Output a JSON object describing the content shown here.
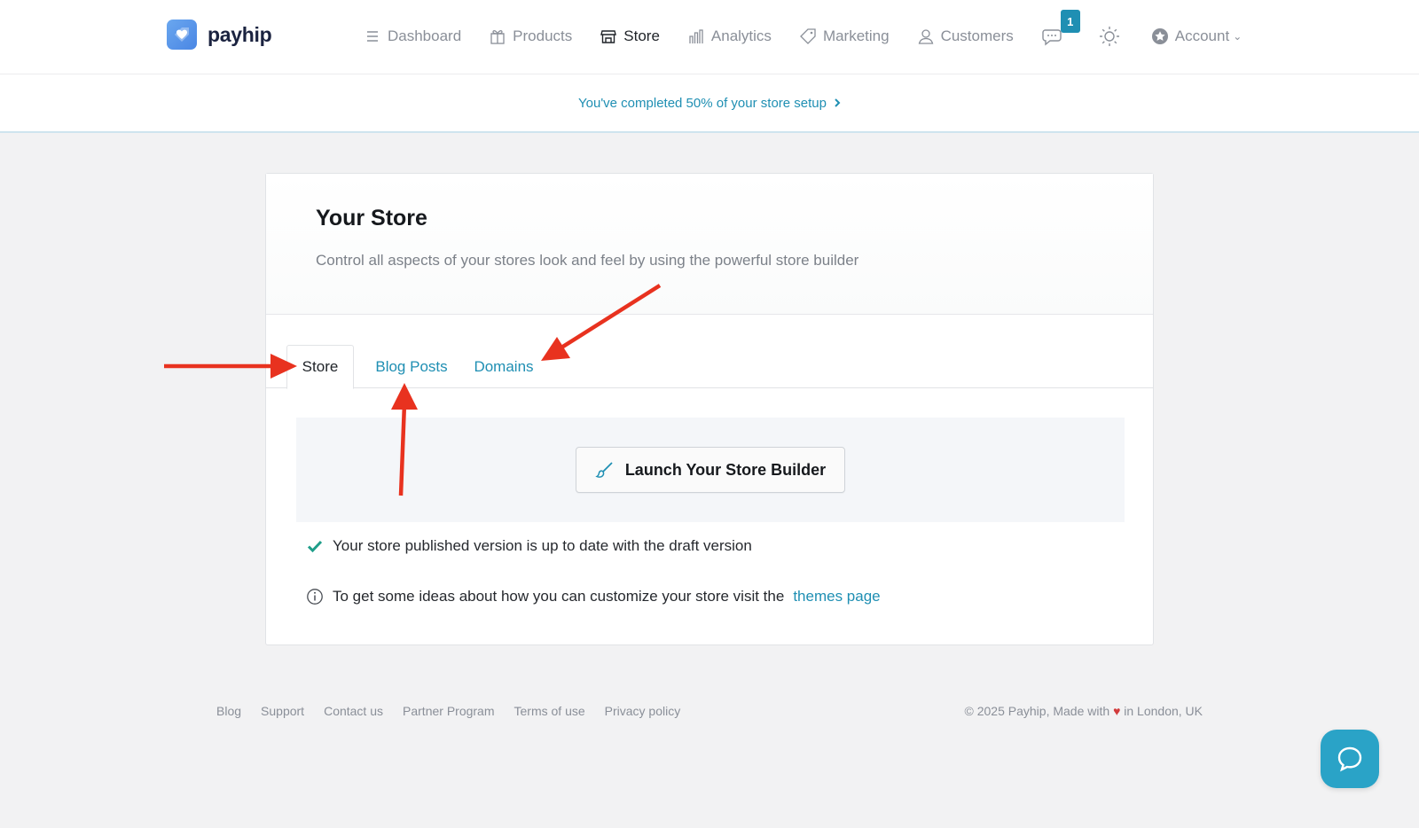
{
  "brand": {
    "name": "payhip"
  },
  "nav": {
    "items": [
      {
        "label": "Dashboard",
        "icon": "menu-icon",
        "active": false
      },
      {
        "label": "Products",
        "icon": "gift-icon",
        "active": false
      },
      {
        "label": "Store",
        "icon": "store-icon",
        "active": true
      },
      {
        "label": "Analytics",
        "icon": "bar-chart-icon",
        "active": false
      },
      {
        "label": "Marketing",
        "icon": "tag-icon",
        "active": false
      },
      {
        "label": "Customers",
        "icon": "user-icon",
        "active": false
      }
    ],
    "messages_badge": "1",
    "account_label": "Account"
  },
  "setup": {
    "message": "You've completed 50% of your store setup"
  },
  "store_card": {
    "title": "Your Store",
    "subtitle": "Control all aspects of your stores look and feel by using the powerful store builder",
    "tabs": [
      {
        "label": "Store",
        "active": true
      },
      {
        "label": "Blog Posts",
        "active": false
      },
      {
        "label": "Domains",
        "active": false
      }
    ],
    "launch_button": "Launch Your Store Builder",
    "status_text": "Your store published version is up to date with the draft version",
    "info_text": "To get some ideas about how you can customize your store visit the",
    "info_link": "themes page"
  },
  "footer": {
    "links": [
      "Blog",
      "Support",
      "Contact us",
      "Partner Program",
      "Terms of use",
      "Privacy policy"
    ],
    "copyright_prefix": "© 2025 Payhip, Made with",
    "copyright_suffix": "in London, UK"
  },
  "colors": {
    "accent": "#1f8fb3",
    "help_button": "#2aa3c7",
    "annotation_arrow": "#e8321f",
    "check": "#1f9e8a"
  }
}
